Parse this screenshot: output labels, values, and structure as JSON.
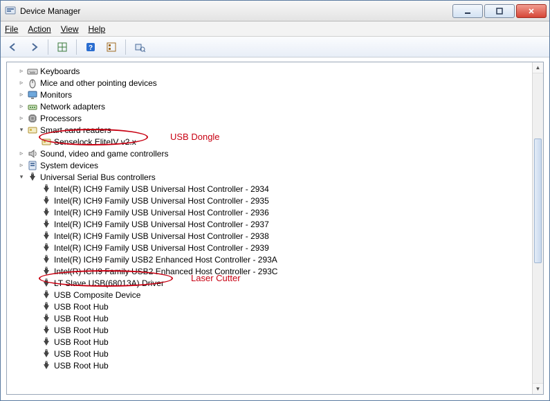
{
  "window": {
    "title": "Device Manager"
  },
  "menu": {
    "file": "File",
    "action": "Action",
    "view": "View",
    "help": "Help"
  },
  "toolbar": {
    "back": "Back",
    "forward": "Forward",
    "show_hidden": "Show hidden devices",
    "help": "Help",
    "properties": "Properties",
    "scan": "Scan for hardware changes"
  },
  "annotations": {
    "usb_dongle": "USB Dongle",
    "laser_cutter": "Laser Cutter"
  },
  "tree": [
    {
      "d": 0,
      "tw": "closed",
      "icon": "keyboard",
      "label": "Keyboards"
    },
    {
      "d": 0,
      "tw": "closed",
      "icon": "mouse",
      "label": "Mice and other pointing devices"
    },
    {
      "d": 0,
      "tw": "closed",
      "icon": "monitor",
      "label": "Monitors"
    },
    {
      "d": 0,
      "tw": "closed",
      "icon": "network",
      "label": "Network adapters"
    },
    {
      "d": 0,
      "tw": "closed",
      "icon": "cpu",
      "label": "Processors"
    },
    {
      "d": 0,
      "tw": "open",
      "icon": "smartcard",
      "label": "Smart card readers"
    },
    {
      "d": 1,
      "tw": "none",
      "icon": "smartcard",
      "label": "Senselock EliteIV v2.x"
    },
    {
      "d": 0,
      "tw": "closed",
      "icon": "sound",
      "label": "Sound, video and game controllers"
    },
    {
      "d": 0,
      "tw": "closed",
      "icon": "system",
      "label": "System devices"
    },
    {
      "d": 0,
      "tw": "open",
      "icon": "usb",
      "label": "Universal Serial Bus controllers"
    },
    {
      "d": 1,
      "tw": "none",
      "icon": "usb",
      "label": "Intel(R) ICH9 Family USB Universal Host Controller - 2934"
    },
    {
      "d": 1,
      "tw": "none",
      "icon": "usb",
      "label": "Intel(R) ICH9 Family USB Universal Host Controller - 2935"
    },
    {
      "d": 1,
      "tw": "none",
      "icon": "usb",
      "label": "Intel(R) ICH9 Family USB Universal Host Controller - 2936"
    },
    {
      "d": 1,
      "tw": "none",
      "icon": "usb",
      "label": "Intel(R) ICH9 Family USB Universal Host Controller - 2937"
    },
    {
      "d": 1,
      "tw": "none",
      "icon": "usb",
      "label": "Intel(R) ICH9 Family USB Universal Host Controller - 2938"
    },
    {
      "d": 1,
      "tw": "none",
      "icon": "usb",
      "label": "Intel(R) ICH9 Family USB Universal Host Controller - 2939"
    },
    {
      "d": 1,
      "tw": "none",
      "icon": "usb",
      "label": "Intel(R) ICH9 Family USB2 Enhanced Host Controller - 293A"
    },
    {
      "d": 1,
      "tw": "none",
      "icon": "usb",
      "label": "Intel(R) ICH9 Family USB2 Enhanced Host Controller - 293C"
    },
    {
      "d": 1,
      "tw": "none",
      "icon": "usb",
      "label": "LT Slave USB(68013A) Driver"
    },
    {
      "d": 1,
      "tw": "none",
      "icon": "usb",
      "label": "USB Composite Device"
    },
    {
      "d": 1,
      "tw": "none",
      "icon": "usb",
      "label": "USB Root Hub"
    },
    {
      "d": 1,
      "tw": "none",
      "icon": "usb",
      "label": "USB Root Hub"
    },
    {
      "d": 1,
      "tw": "none",
      "icon": "usb",
      "label": "USB Root Hub"
    },
    {
      "d": 1,
      "tw": "none",
      "icon": "usb",
      "label": "USB Root Hub"
    },
    {
      "d": 1,
      "tw": "none",
      "icon": "usb",
      "label": "USB Root Hub"
    },
    {
      "d": 1,
      "tw": "none",
      "icon": "usb",
      "label": "USB Root Hub"
    }
  ],
  "icons": {
    "keyboard": "keyboard-icon",
    "mouse": "mouse-icon",
    "monitor": "monitor-icon",
    "network": "network-icon",
    "cpu": "cpu-icon",
    "smartcard": "smartcard-icon",
    "sound": "sound-icon",
    "system": "system-icon",
    "usb": "usb-icon"
  }
}
